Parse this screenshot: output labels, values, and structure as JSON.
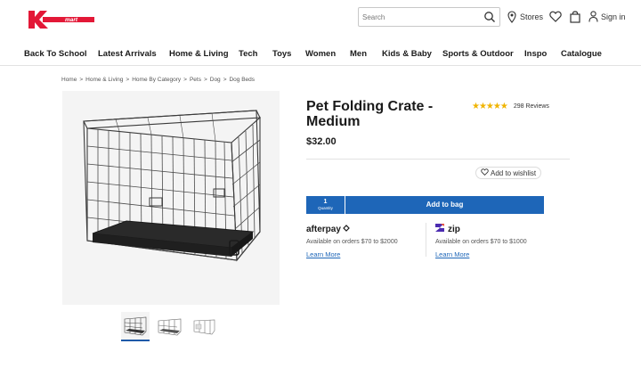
{
  "header": {
    "search_placeholder": "Search",
    "stores_label": "Stores",
    "signin_label": "Sign in",
    "logo_text": "mart",
    "brand_color": "#e31837"
  },
  "nav": {
    "items": [
      "Back To School",
      "Latest Arrivals",
      "Home & Living",
      "Tech",
      "Toys",
      "Women",
      "Men",
      "Kids & Baby",
      "Sports & Outdoor",
      "Inspo",
      "Catalogue"
    ]
  },
  "breadcrumb": [
    "Home",
    "Home & Living",
    "Home By Category",
    "Pets",
    "Dog",
    "Dog Beds"
  ],
  "breadcrumb_separator": ">",
  "product": {
    "title": "Pet Folding Crate - Medium",
    "price": "$32.00",
    "rating": 4.5,
    "stars": "★★★★★",
    "reviews": "298 Reviews",
    "wishlist_label": "Add to wishlist",
    "quantity": "1",
    "quantity_label": "Quantity",
    "add_to_bag_label": "Add to bag",
    "accent_color": "#1e66b8"
  },
  "payments": {
    "afterpay": {
      "name": "afterpay",
      "note": "Available on orders $70 to $2000",
      "learn_more": "Learn More"
    },
    "zip": {
      "name": "zip",
      "note": "Available on orders $70 to $1000",
      "learn_more": "Learn More"
    }
  },
  "icons": [
    "search-icon",
    "location-pin-icon",
    "heart-icon",
    "bag-icon",
    "user-icon"
  ]
}
